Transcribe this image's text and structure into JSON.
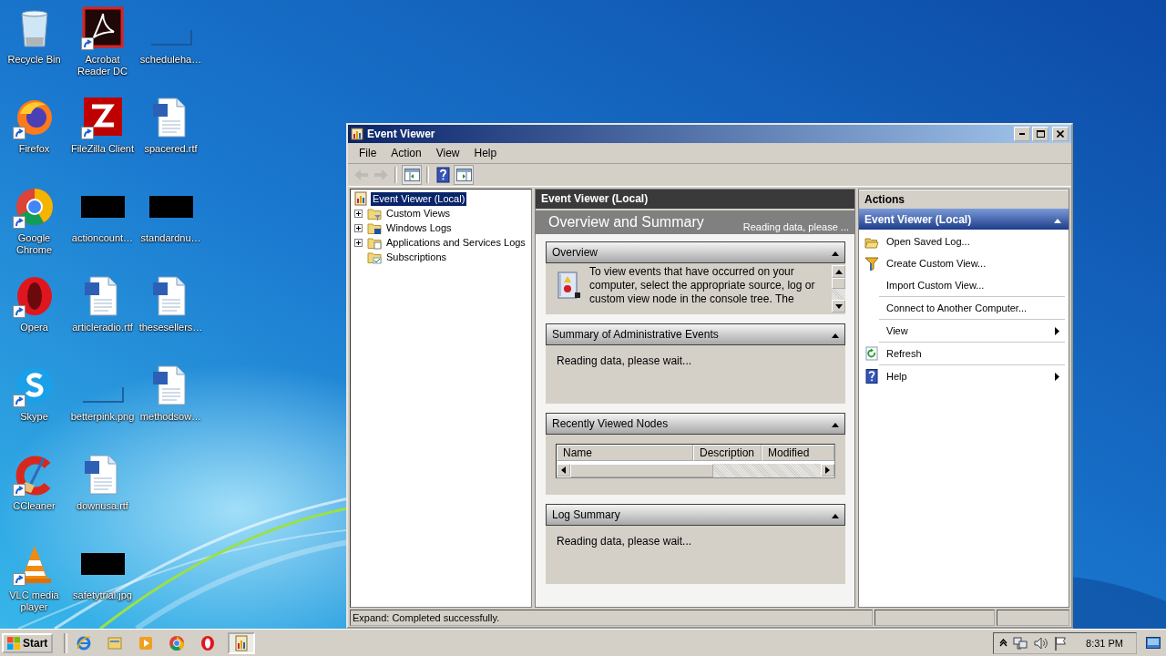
{
  "desktop_icons": [
    {
      "label": "Recycle Bin",
      "kind": "recycle",
      "shortcut": false
    },
    {
      "label": "Firefox",
      "kind": "firefox",
      "shortcut": true
    },
    {
      "label": "Google Chrome",
      "kind": "chrome",
      "shortcut": true
    },
    {
      "label": "Opera",
      "kind": "opera",
      "shortcut": true
    },
    {
      "label": "Skype",
      "kind": "skype",
      "shortcut": true
    },
    {
      "label": "CCleaner",
      "kind": "ccleaner",
      "shortcut": true
    },
    {
      "label": "VLC media player",
      "kind": "vlc",
      "shortcut": true
    },
    {
      "label": "Acrobat Reader DC",
      "kind": "acrobat",
      "shortcut": true
    },
    {
      "label": "FileZilla Client",
      "kind": "filezilla",
      "shortcut": true
    },
    {
      "label": "actioncount…",
      "kind": "dark",
      "shortcut": false
    },
    {
      "label": "articleradio.rtf",
      "kind": "document",
      "shortcut": false
    },
    {
      "label": "betterpink.png",
      "kind": "blank",
      "shortcut": false
    },
    {
      "label": "downusa.rtf",
      "kind": "document",
      "shortcut": false
    },
    {
      "label": "safetytrial.jpg",
      "kind": "dark",
      "shortcut": false
    },
    {
      "label": "scheduleha…",
      "kind": "blank",
      "shortcut": false
    },
    {
      "label": "spacered.rtf",
      "kind": "document",
      "shortcut": false
    },
    {
      "label": "standardnu…",
      "kind": "dark",
      "shortcut": false
    },
    {
      "label": "thesesellers…",
      "kind": "document",
      "shortcut": false
    },
    {
      "label": "methodsow…",
      "kind": "document",
      "shortcut": false
    }
  ],
  "window": {
    "title": "Event Viewer",
    "menu": [
      "File",
      "Action",
      "View",
      "Help"
    ],
    "toolbar": [
      [
        {
          "kind": "back",
          "disabled": true
        },
        {
          "kind": "forward",
          "disabled": true
        }
      ],
      [
        {
          "kind": "tree-pane",
          "disabled": false
        }
      ],
      [
        {
          "kind": "help",
          "disabled": false
        },
        {
          "kind": "action-pane",
          "disabled": false
        }
      ]
    ],
    "tree": {
      "label": "Event Viewer (Local)",
      "kind": "root",
      "selected": true,
      "children": [
        {
          "label": "Custom Views",
          "kind": "folder-filter",
          "selected": false,
          "expandable": true
        },
        {
          "label": "Windows Logs",
          "kind": "folder-log",
          "selected": false,
          "expandable": true
        },
        {
          "label": "Applications and Services Logs",
          "kind": "folder",
          "selected": false,
          "expandable": true
        },
        {
          "label": "Subscriptions",
          "kind": "folder-subscription",
          "selected": false,
          "expandable": false
        }
      ]
    },
    "center": {
      "header": "Event Viewer (Local)",
      "title": "Overview and Summary",
      "status": "Reading data, please ...",
      "sections": [
        {
          "title": "Overview",
          "kind": "info",
          "text": "To view events that have occurred on your computer, select the appropriate source, log or custom view node in the console tree. The"
        },
        {
          "title": "Summary of Administrative Events",
          "kind": "message",
          "text": "Reading data, please wait..."
        },
        {
          "title": "Recently Viewed Nodes",
          "kind": "table",
          "columns": [
            "Name",
            "Description",
            "Modified"
          ]
        },
        {
          "title": "Log Summary",
          "kind": "message",
          "text": "Reading data, please wait..."
        }
      ]
    },
    "actions": {
      "header": "Actions",
      "group": "Event Viewer (Local)",
      "items": [
        {
          "label": "Open Saved Log...",
          "kind": "open",
          "submenu": false,
          "divider_above": false
        },
        {
          "label": "Create Custom View...",
          "kind": "filter",
          "submenu": false,
          "divider_above": false
        },
        {
          "label": "Import Custom View...",
          "kind": "plain",
          "submenu": false,
          "divider_above": false
        },
        {
          "label": "Connect to Another Computer...",
          "kind": "plain",
          "submenu": false,
          "divider_above": true
        },
        {
          "label": "View",
          "kind": "plain",
          "submenu": true,
          "divider_above": true
        },
        {
          "label": "Refresh",
          "kind": "refresh",
          "submenu": false,
          "divider_above": true
        },
        {
          "label": "Help",
          "kind": "help",
          "submenu": true,
          "divider_above": true
        }
      ]
    },
    "status_bar": {
      "text": "Expand:  Completed successfully."
    }
  },
  "taskbar": {
    "start": "Start",
    "apps": [
      {
        "kind": "ie",
        "active": false
      },
      {
        "kind": "explorer",
        "active": false
      },
      {
        "kind": "media",
        "active": false
      },
      {
        "kind": "chrome",
        "active": false
      },
      {
        "kind": "opera",
        "active": false
      },
      {
        "kind": "event-viewer",
        "active": true
      }
    ],
    "time": "8:31 PM"
  }
}
